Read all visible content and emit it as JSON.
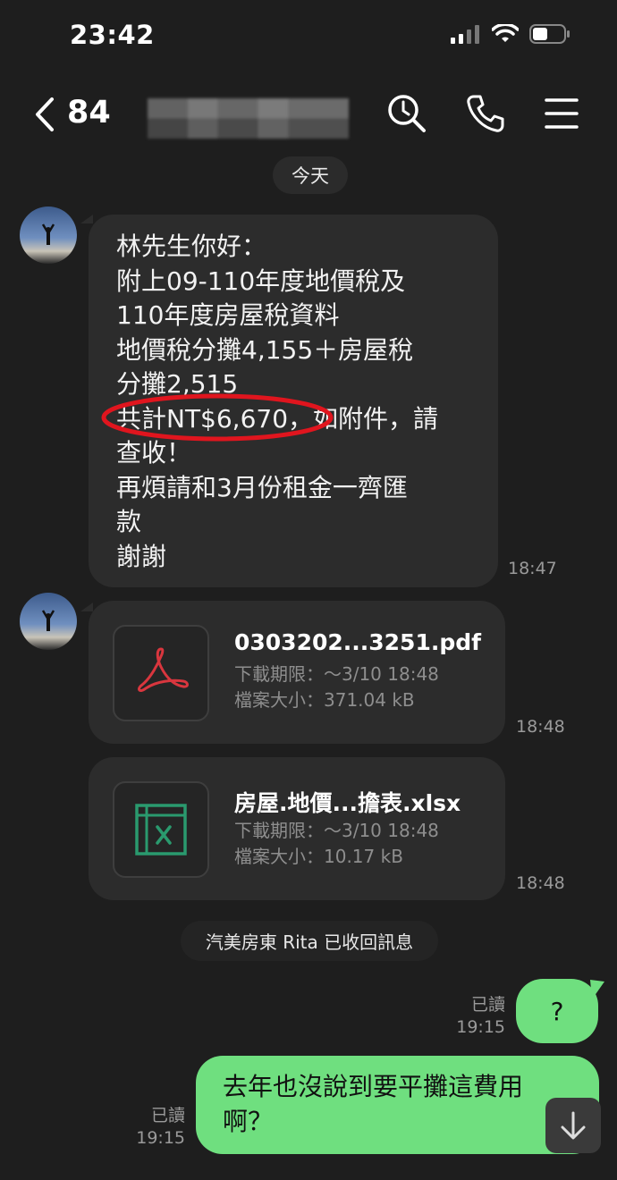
{
  "status_bar": {
    "time": "23:42"
  },
  "header": {
    "unread_count": "84"
  },
  "date_separator": "今天",
  "messages": [
    {
      "text": "林先生你好：\n附上09-110年度地價稅及\n110年度房屋稅資料\n地價稅分攤4,155＋房屋稅\n分攤2,515\n共計NT$6,670，如附件，請\n查收！\n再煩請和3月份租金一齊匯\n款\n謝謝",
      "time": "18:47"
    }
  ],
  "files": [
    {
      "name": "0303202...3251.pdf",
      "expiry": "下載期限：～3/10 18:48",
      "size": "檔案大小：371.04 kB",
      "time": "18:48",
      "icon": "pdf-icon",
      "color": "#d9363e"
    },
    {
      "name": "房屋.地價...擔表.xlsx",
      "expiry": "下載期限：～3/10 18:48",
      "size": "檔案大小：10.17 kB",
      "time": "18:48",
      "icon": "excel-icon",
      "color": "#2a9a6e"
    }
  ],
  "system_notice": "汽美房東 Rita 已收回訊息",
  "outgoing": [
    {
      "text": "?",
      "read": "已讀",
      "time": "19:15"
    },
    {
      "text": "去年也沒說到要平攤這費用\n啊？",
      "read": "已讀",
      "time": "19:15"
    }
  ],
  "colors": {
    "background": "#1e1e1e",
    "incoming_bubble": "#2c2c2c",
    "outgoing_bubble": "#6fdf7f",
    "highlight_circle": "#e0151e"
  }
}
